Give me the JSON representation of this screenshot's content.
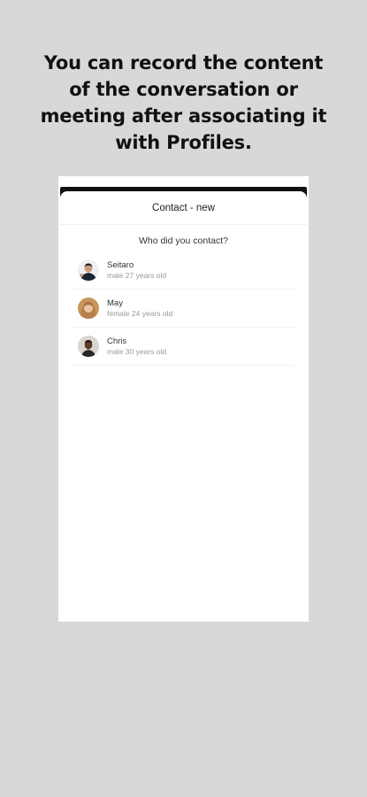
{
  "headline": "You can record the content\nof the conversation or\nmeeting after associating it\nwith Profiles.",
  "sheet": {
    "title": "Contact - new",
    "question": "Who did you contact?"
  },
  "contacts": [
    {
      "name": "Seitaro",
      "meta": "male 27 years old",
      "avatar": "person-avatar-1"
    },
    {
      "name": "May",
      "meta": "female 24 years old",
      "avatar": "person-avatar-2"
    },
    {
      "name": "Chris",
      "meta": "male 30 years old",
      "avatar": "person-avatar-3"
    }
  ],
  "colors": {
    "background": "#d8d8d8",
    "headline": "#111111",
    "card": "#ffffff",
    "meta_text": "#999999"
  }
}
